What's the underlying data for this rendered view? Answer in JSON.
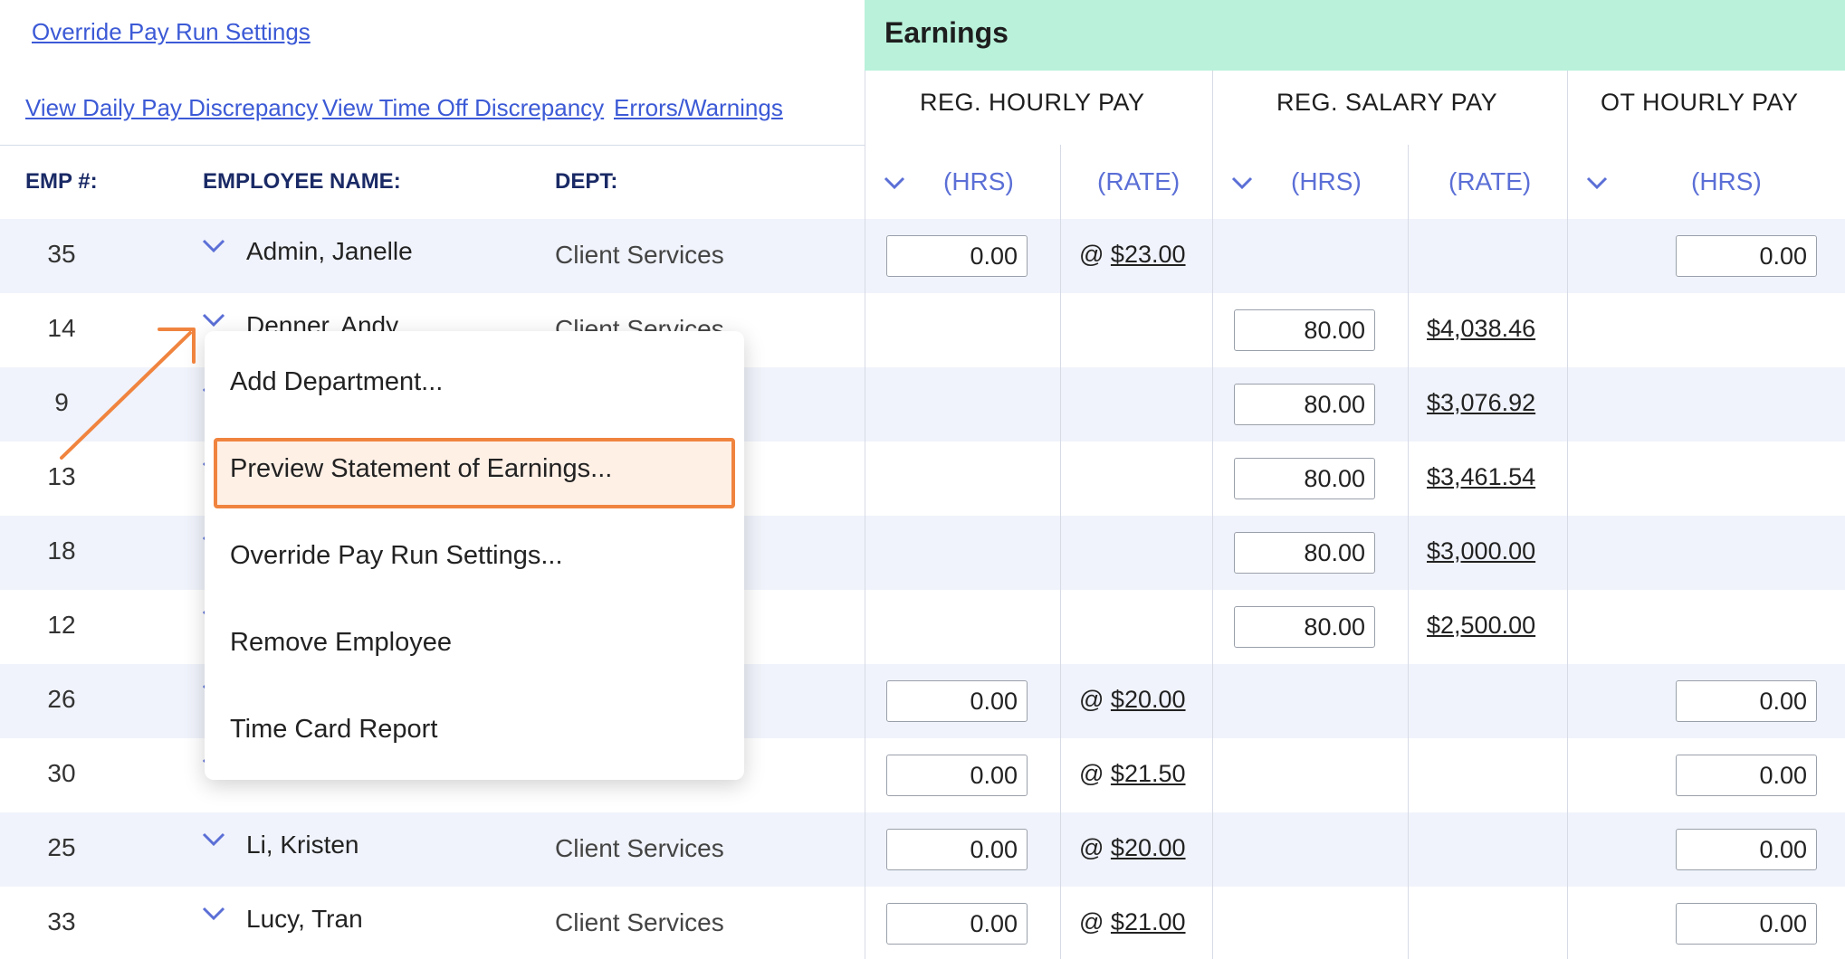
{
  "links": {
    "override": "Override Pay Run Settings",
    "daily": "View Daily Pay Discrepancy",
    "timeoff": "View Time Off Discrepancy",
    "errors": "Errors/Warnings"
  },
  "earnings": {
    "title": "Earnings",
    "groups": [
      "REG. HOURLY PAY",
      "REG. SALARY PAY",
      "OT HOURLY PAY"
    ],
    "hrs": "(HRS)",
    "rate": "(RATE)"
  },
  "columns": {
    "emp": "EMP #:",
    "name": "EMPLOYEE NAME:",
    "dept": "DEPT:"
  },
  "rows": [
    {
      "emp": "35",
      "name": "Admin, Janelle",
      "dept": "Client Services",
      "reg_hrs": "0.00",
      "reg_rate_prefix": "@ ",
      "reg_rate": "$23.00",
      "sal_hrs": "",
      "sal_rate": "",
      "ot_hrs": "0.00"
    },
    {
      "emp": "14",
      "name": "Denner, Andy",
      "dept": "Client Services",
      "reg_hrs": "",
      "reg_rate_prefix": "",
      "reg_rate": "",
      "sal_hrs": "80.00",
      "sal_rate": "$4,038.46",
      "ot_hrs": ""
    },
    {
      "emp": "9",
      "name": "",
      "dept": "",
      "reg_hrs": "",
      "reg_rate_prefix": "",
      "reg_rate": "",
      "sal_hrs": "80.00",
      "sal_rate": "$3,076.92",
      "ot_hrs": ""
    },
    {
      "emp": "13",
      "name": "",
      "dept": "",
      "reg_hrs": "",
      "reg_rate_prefix": "",
      "reg_rate": "",
      "sal_hrs": "80.00",
      "sal_rate": "$3,461.54",
      "ot_hrs": ""
    },
    {
      "emp": "18",
      "name": "",
      "dept": "",
      "reg_hrs": "",
      "reg_rate_prefix": "",
      "reg_rate": "",
      "sal_hrs": "80.00",
      "sal_rate": "$3,000.00",
      "ot_hrs": ""
    },
    {
      "emp": "12",
      "name": "",
      "dept": "",
      "reg_hrs": "",
      "reg_rate_prefix": "",
      "reg_rate": "",
      "sal_hrs": "80.00",
      "sal_rate": "$2,500.00",
      "ot_hrs": ""
    },
    {
      "emp": "26",
      "name": "",
      "dept": "",
      "reg_hrs": "0.00",
      "reg_rate_prefix": "@ ",
      "reg_rate": "$20.00",
      "sal_hrs": "",
      "sal_rate": "",
      "ot_hrs": "0.00"
    },
    {
      "emp": "30",
      "name": "",
      "dept": "",
      "reg_hrs": "0.00",
      "reg_rate_prefix": "@ ",
      "reg_rate": "$21.50",
      "sal_hrs": "",
      "sal_rate": "",
      "ot_hrs": "0.00"
    },
    {
      "emp": "25",
      "name": "Li, Kristen",
      "dept": "Client Services",
      "reg_hrs": "0.00",
      "reg_rate_prefix": "@ ",
      "reg_rate": "$20.00",
      "sal_hrs": "",
      "sal_rate": "",
      "ot_hrs": "0.00"
    },
    {
      "emp": "33",
      "name": "Lucy, Tran",
      "dept": "Client Services",
      "reg_hrs": "0.00",
      "reg_rate_prefix": "@ ",
      "reg_rate": "$21.00",
      "sal_hrs": "",
      "sal_rate": "",
      "ot_hrs": "0.00"
    }
  ],
  "menu": {
    "items": [
      "Add Department...",
      "Preview Statement of Earnings...",
      "Override Pay Run Settings...",
      "Remove Employee",
      "Time Card Report"
    ],
    "highlight_color": "#f0843f"
  },
  "colors": {
    "earnings_band": "#b9f1da",
    "link": "#3c5ad6",
    "header": "#1a2a66",
    "alt_row": "#f0f3fb"
  }
}
